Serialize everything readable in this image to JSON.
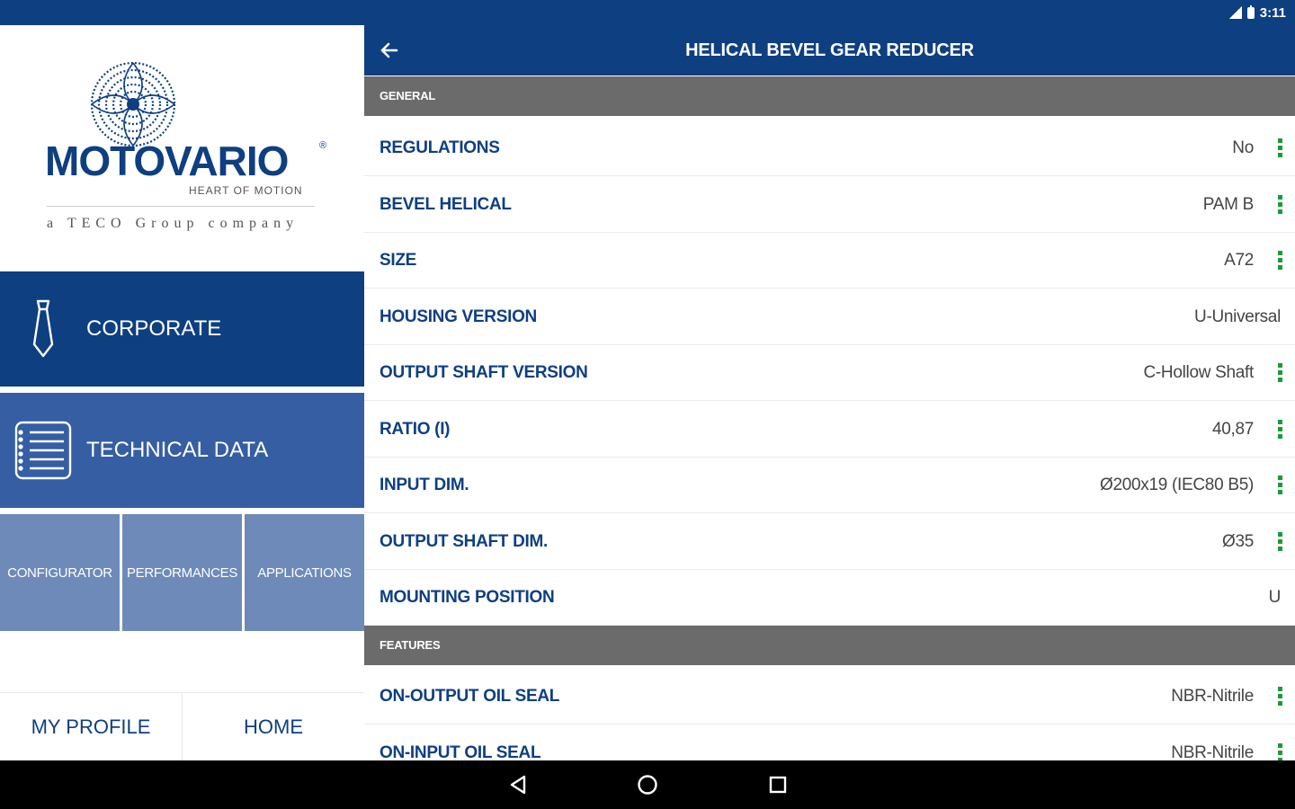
{
  "status_bar": {
    "time": "3:11"
  },
  "logo": {
    "name": "MOTOVARIO",
    "registered_mark": "®",
    "tagline": "HEART OF MOTION",
    "group_line": "a TECO Group company"
  },
  "sidebar": {
    "corporate_label": "CORPORATE",
    "technical_label": "TECHNICAL DATA",
    "sub_items": [
      "CONFIGURATOR",
      "PERFORMANCES",
      "APPLICATIONS"
    ],
    "bottom_links": [
      "MY PROFILE",
      "HOME"
    ]
  },
  "header": {
    "title": "HELICAL BEVEL GEAR REDUCER"
  },
  "sections": {
    "general": "GENERAL",
    "features": "FEATURES"
  },
  "rows": [
    {
      "label": "REGULATIONS",
      "value": "No",
      "menu": true
    },
    {
      "label": "BEVEL HELICAL",
      "value": "PAM B",
      "menu": true
    },
    {
      "label": "SIZE",
      "value": "A72",
      "menu": true
    },
    {
      "label": "HOUSING VERSION",
      "value": "U-Universal",
      "menu": false
    },
    {
      "label": "OUTPUT SHAFT VERSION",
      "value": "C-Hollow Shaft",
      "menu": true
    },
    {
      "label": "RATIO (I)",
      "value": "40,87",
      "menu": true
    },
    {
      "label": "INPUT DIM.",
      "value": "Ø200x19 (IEC80 B5)",
      "menu": true
    },
    {
      "label": "OUTPUT SHAFT DIM.",
      "value": "Ø35",
      "menu": true
    },
    {
      "label": "MOUNTING POSITION",
      "value": "U",
      "menu": false
    },
    {
      "label": "ON-OUTPUT OIL SEAL",
      "value": "NBR-Nitrile",
      "menu": true
    },
    {
      "label": "ON-INPUT OIL SEAL",
      "value": "NBR-Nitrile",
      "menu": true
    }
  ],
  "colors": {
    "brand_blue": "#0e3f81",
    "technical_blue": "#355ea3",
    "sub_nav_blue": "#6d8ab9",
    "section_gray": "#6b6b6b",
    "menu_green": "#1a9b3a"
  },
  "icons": {
    "back": "arrow-left-icon",
    "corporate": "tie-icon",
    "technical": "notebook-icon",
    "row_menu": "more-vert-icon",
    "nav_back": "triangle-back-icon",
    "nav_home": "circle-home-icon",
    "nav_recents": "square-recents-icon"
  }
}
